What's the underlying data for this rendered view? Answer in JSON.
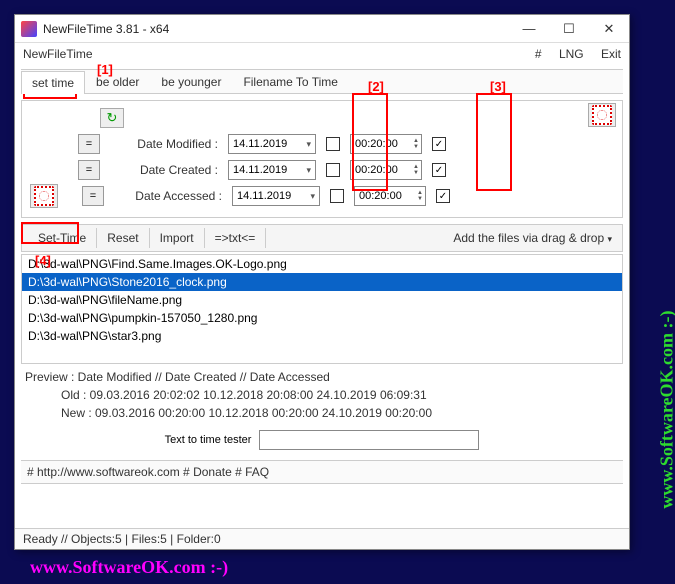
{
  "bg": {
    "right": "www.SoftwareOK.com :-)",
    "bottom": "www.SoftwareOK.com :-)"
  },
  "title": "NewFileTime 3.81 - x64",
  "menubar": {
    "left": "NewFileTime",
    "hash": "#",
    "lng": "LNG",
    "exit": "Exit"
  },
  "tabs": {
    "set_time": "set time",
    "be_older": "be older",
    "be_younger": "be younger",
    "filename_to_time": "Filename To Time"
  },
  "annotations": {
    "a1": "[1]",
    "a2": "[2]",
    "a3": "[3]",
    "a4": "[4]"
  },
  "rows": {
    "modified": {
      "label": "Date Modified :",
      "date": "14.11.2019",
      "time": "00:20:00",
      "enabled": true
    },
    "created": {
      "label": "Date Created :",
      "date": "14.11.2019",
      "time": "00:20:00",
      "enabled": true
    },
    "accessed": {
      "label": "Date Accessed :",
      "date": "14.11.2019",
      "time": "00:20:00",
      "enabled": true
    }
  },
  "toolbar2": {
    "set_time": "Set-Time",
    "reset": "Reset",
    "import": "Import",
    "txt": "=>txt<=",
    "hint": "Add the files via drag & drop"
  },
  "files": [
    "D:\\3d-wal\\PNG\\Find.Same.Images.OK-Logo.png",
    "D:\\3d-wal\\PNG\\Stone2016_clock.png",
    "D:\\3d-wal\\PNG\\fileName.png",
    "D:\\3d-wal\\PNG\\pumpkin-157050_1280.png",
    "D:\\3d-wal\\PNG\\star3.png"
  ],
  "selected_index": 1,
  "preview": {
    "header": "Preview :   Date Modified   //   Date Created   //   Date Accessed",
    "old": "Old : 09.03.2016 20:02:02     10.12.2018 20:08:00     24.10.2019 06:09:31",
    "new": "New : 09.03.2016 00:20:00     10.12.2018 00:20:00     24.10.2019 00:20:00"
  },
  "tester_label": "Text to time tester",
  "linkbar": "# http://www.softwareok.com     # Donate     # FAQ",
  "statusbar": "Ready  // Objects:5 | Files:5 | Folder:0"
}
